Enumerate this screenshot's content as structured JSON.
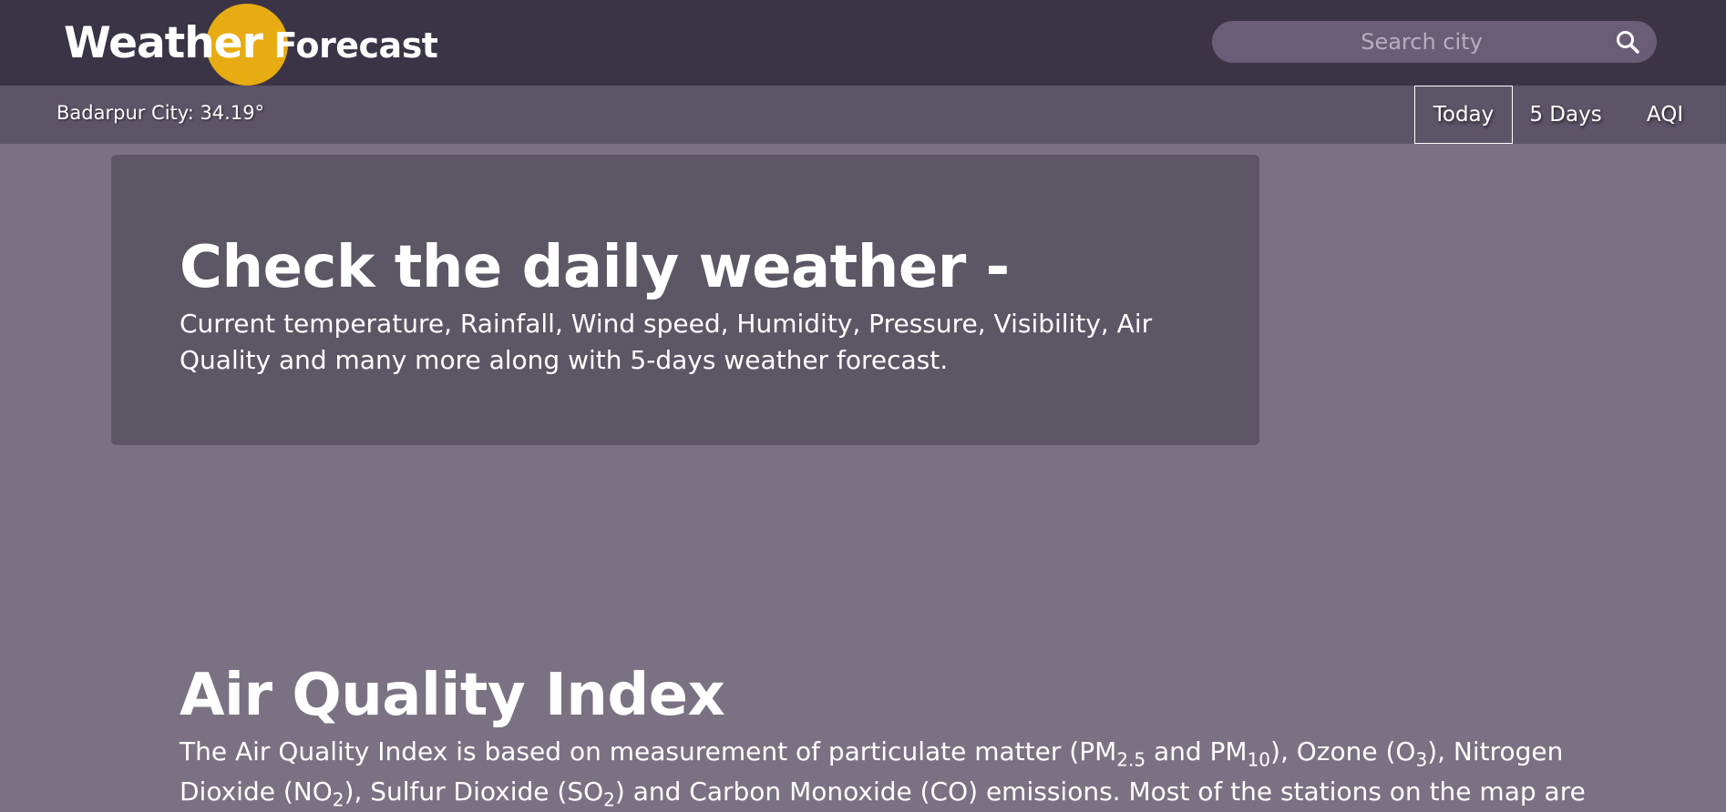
{
  "header": {
    "logo_word1": "Weather",
    "logo_word2": "Forecast",
    "search_placeholder": "Search city",
    "search_icon": "search-icon"
  },
  "subbar": {
    "city_temp": "Badarpur City: 34.19°",
    "tabs": [
      {
        "label": "Today",
        "active": true
      },
      {
        "label": "5 Days",
        "active": false
      },
      {
        "label": "AQI",
        "active": false
      }
    ]
  },
  "hero": {
    "title": "Check the daily weather -",
    "description": "Current temperature, Rainfall, Wind speed, Humidity, Pressure, Visibility, Air Quality and many more along with 5-days weather forecast."
  },
  "aqi": {
    "title": "Air Quality Index",
    "desc": {
      "t1": "The Air Quality Index is based on measurement of particulate matter (PM",
      "s1": "2.5",
      "t2": " and PM",
      "s2": "10",
      "t3": "), Ozone (O",
      "s3": "3",
      "t4": "), Nitrogen Dioxide (NO",
      "s4": "2",
      "t5": "), Sulfur Dioxide (SO",
      "s5": "2",
      "t6": ") and Carbon Monoxide (CO) emissions. Most of the stations on the map are"
    }
  },
  "colors": {
    "topbar": "#3b3446",
    "subbar": "#5c5467",
    "page_bg": "#7a7282",
    "hero_bg": "#5c5665",
    "sun": "#e6ac12",
    "search_bg": "#695d78"
  }
}
